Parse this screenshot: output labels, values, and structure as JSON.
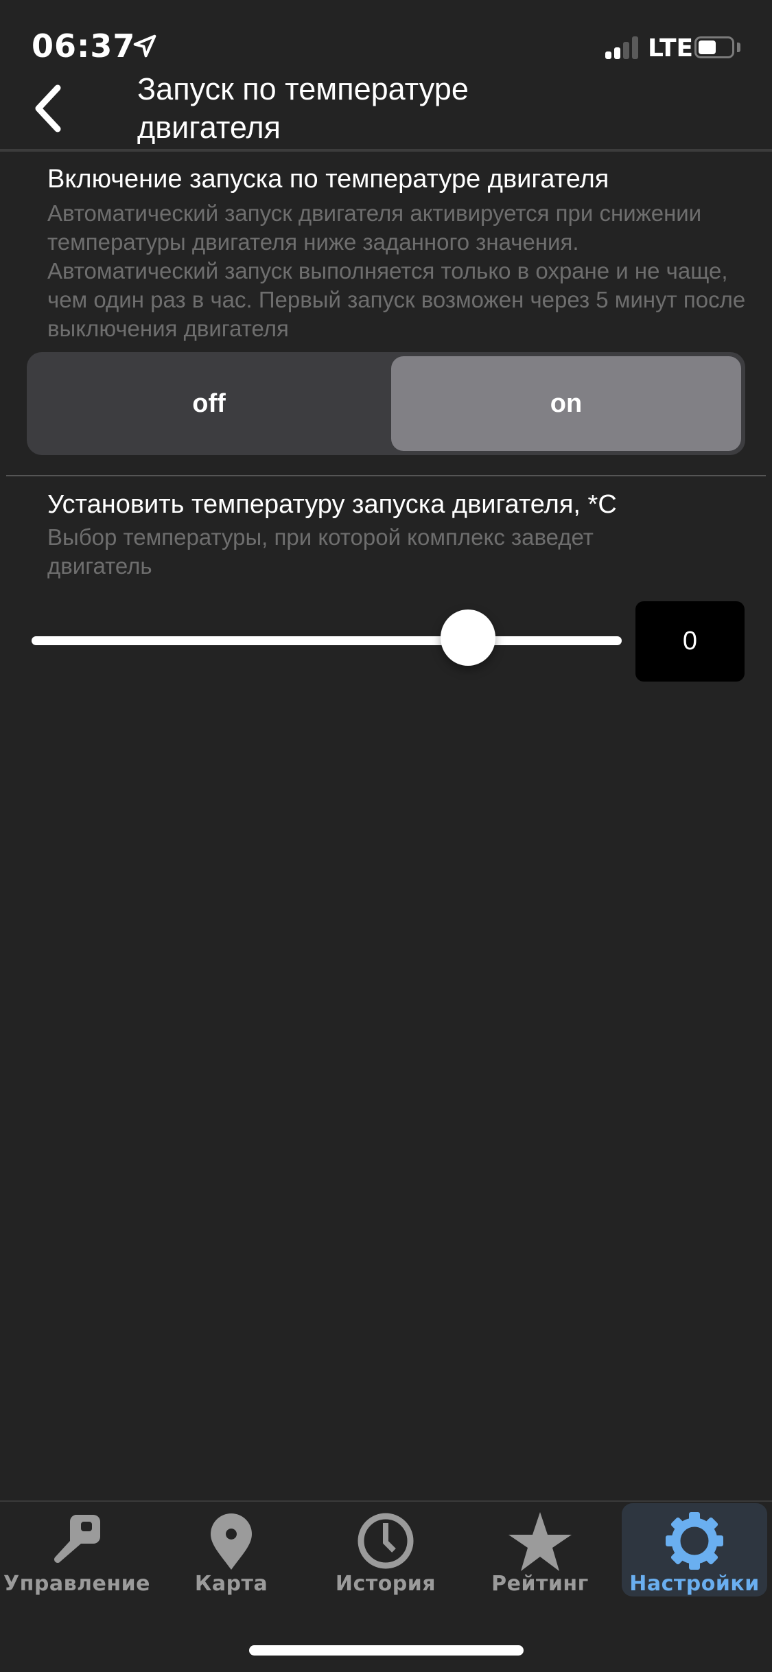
{
  "status_bar": {
    "time": "06:37",
    "network": "LTE",
    "signal_bars_active": 2,
    "signal_bars_total": 4,
    "battery_level": 0.55,
    "location_icon": "location-arrow-icon"
  },
  "header": {
    "back_icon": "chevron-left-icon",
    "title": "Запуск по температуре двигателя"
  },
  "section_enable": {
    "title": "Включение запуска по температуре двигателя",
    "description": "Автоматический запуск двигателя активируется при снижении температуры двигателя ниже заданного значения. Автоматический запуск выполняется только в охране и не чаще, чем один раз в час. Первый запуск возможен через 5 минут после выключения двигателя",
    "segment": {
      "off_label": "off",
      "on_label": "on",
      "selected": "on"
    }
  },
  "section_temperature": {
    "title": "Установить температуру запуска двигателя, *C",
    "description": "Выбор температуры, при которой комплекс заведет двигатель",
    "slider_fraction": 0.74,
    "value": "0"
  },
  "tab_bar": {
    "active_color": "#6aaff0",
    "inactive_color": "#9b9b9b",
    "items": [
      {
        "label": "Управление",
        "icon": "key-icon",
        "active": false
      },
      {
        "label": "Карта",
        "icon": "map-pin-icon",
        "active": false
      },
      {
        "label": "История",
        "icon": "clock-icon",
        "active": false
      },
      {
        "label": "Рейтинг",
        "icon": "star-icon",
        "active": false
      },
      {
        "label": "Настройки",
        "icon": "gear-icon",
        "active": true
      }
    ]
  }
}
